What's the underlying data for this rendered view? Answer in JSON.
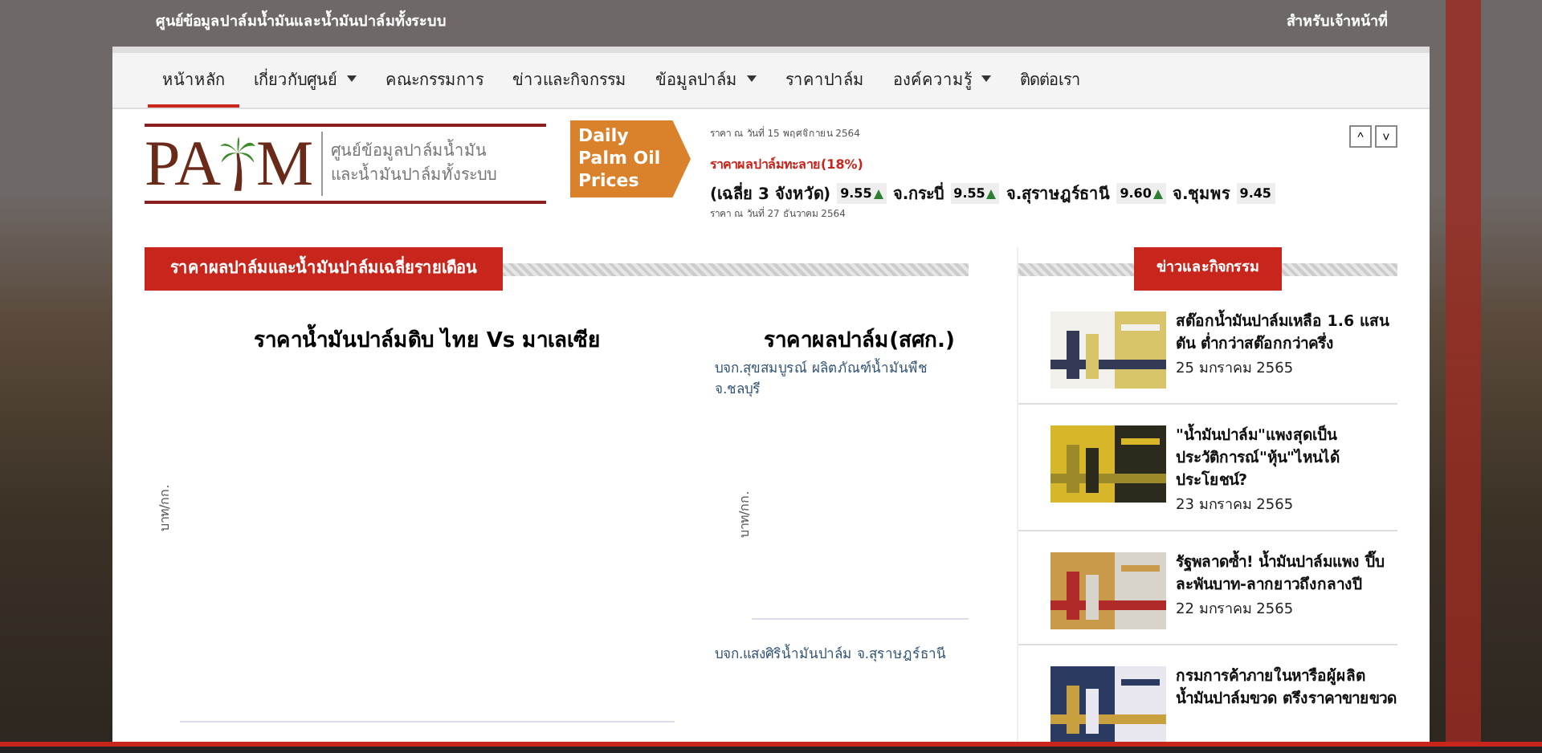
{
  "top_bar": {
    "site_name": "ศูนย์ข้อมูลปาล์มน้ำมันและน้ำมันปาล์มทั้งระบบ",
    "staff_link": "สำหรับเจ้าหน้าที่"
  },
  "nav": [
    {
      "label": "หน้าหลัก",
      "selected": true,
      "dropdown": false
    },
    {
      "label": "เกี่ยวกับศูนย์",
      "selected": false,
      "dropdown": true
    },
    {
      "label": "คณะกรรมการ",
      "selected": false,
      "dropdown": false
    },
    {
      "label": "ข่าวและกิจกรรม",
      "selected": false,
      "dropdown": false
    },
    {
      "label": "ข้อมูลปาล์ม",
      "selected": false,
      "dropdown": true
    },
    {
      "label": "ราคาปาล์ม",
      "selected": false,
      "dropdown": false
    },
    {
      "label": "องค์ความรู้",
      "selected": false,
      "dropdown": true
    },
    {
      "label": "ติดต่อเรา",
      "selected": false,
      "dropdown": false
    }
  ],
  "logo": {
    "wordmark_left": "PA",
    "wordmark_right": "M",
    "line_1": "ศูนย์ข้อมูลปาล์มน้ำมัน",
    "line_2": "และน้ำมันปาล์มทั้งระบบ"
  },
  "daily_badge": "Daily\nPalm Oil\nPrices",
  "ticker": {
    "date_top": "ราคา ณ วันที่ 15 พฤศจิกายน 2564",
    "title": "ราคาผลปาล์มทะลาย(18%)",
    "date_bottom": "ราคา ณ วันที่ 27 ธันวาคม 2564",
    "prices": [
      {
        "label": "(เฉลี่ย 3 จังหวัด)",
        "value": "9.55",
        "rising": true
      },
      {
        "label": "จ.กระบี่",
        "value": "9.55",
        "rising": true
      },
      {
        "label": "จ.สุราษฎร์ธานี",
        "value": "9.60",
        "rising": true
      },
      {
        "label": "จ.ชุมพร",
        "value": "9.45",
        "rising": false
      }
    ],
    "controls": [
      "^",
      "˅"
    ]
  },
  "main_section": {
    "heading": "ราคาผลปาล์มและน้ำมันปาล์มเฉลี่ยรายเดือน",
    "left_chart": {
      "title": "ราคาน้ำมันปาล์มดิบ ไทย Vs มาเลเซีย",
      "ylabel": "บาท/กก."
    },
    "right_chart": {
      "title": "ราคาผลปาล์ม(สศก.)",
      "source_top": "บจก.สุขสมบูรณ์ ผลิตภัณฑ์น้ำมันพืช จ.ชลบุรี",
      "ylabel": "บาท/กก.",
      "source_bottom": "บจก.แสงศิริน้ำมันปาล์ม จ.สุราษฎร์ธานี"
    }
  },
  "news": {
    "heading": "ข่าวและกิจกรรม",
    "items": [
      {
        "title": "สต๊อกน้ำมันปาล์มเหลือ 1.6 แสนตัน ต่ำกว่าสต๊อกกว่าครึ่ง",
        "date": "25 มกราคม 2565",
        "kind": "picture"
      },
      {
        "title": "\"น้ำมันปาล์ม\"แพงสุดเป็นประวัติการณ์\"หุ้น\"ไหนได้ประโยชน์?",
        "date": "23 มกราคม 2565",
        "kind": "picture"
      },
      {
        "title": "รัฐพลาดซ้ำ! น้ำมันปาล์มแพง ปี๊บละพันบาท-ลากยาวถึงกลางปี",
        "date": "22 มกราคม 2565",
        "kind": "picture"
      },
      {
        "title": "กรมการค้าภายในหารือผู้ผลิตน้ำมันปาล์มขวด ตรึงราคาขายขวด",
        "kind": "picture"
      }
    ]
  }
}
